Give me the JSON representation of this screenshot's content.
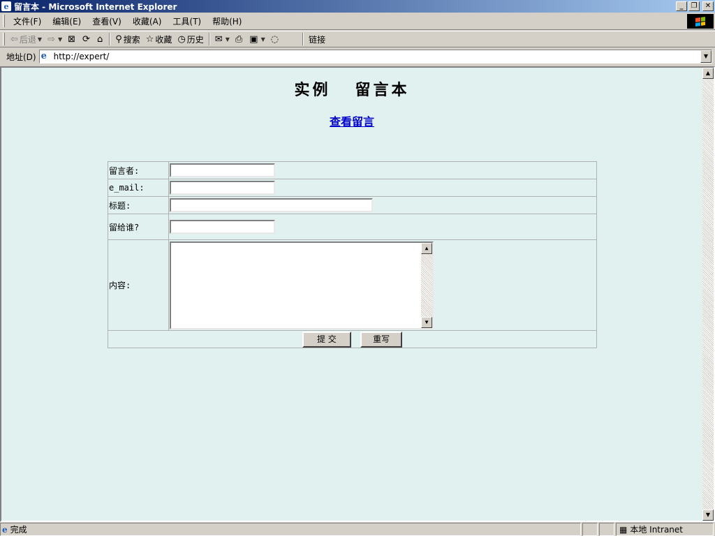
{
  "window": {
    "title": "留言本 - Microsoft Internet Explorer",
    "buttons": {
      "minimize": "_",
      "maximize": "❐",
      "close": "✕"
    }
  },
  "menu": {
    "items": [
      "文件(F)",
      "编辑(E)",
      "查看(V)",
      "收藏(A)",
      "工具(T)",
      "帮助(H)"
    ]
  },
  "toolbar": {
    "back": "后退",
    "search": "搜索",
    "favorites": "收藏",
    "history": "历史",
    "links": "链接",
    "icons": [
      "back-arrow-icon",
      "forward-arrow-icon",
      "stop-icon",
      "refresh-icon",
      "home-icon",
      "search-icon",
      "favorites-icon",
      "history-icon",
      "mail-icon",
      "print-icon",
      "edit-icon",
      "discuss-icon"
    ]
  },
  "address": {
    "label": "地址(D)",
    "url": "http://expert/"
  },
  "page": {
    "title": "实例   留言本",
    "link": "查看留言",
    "form": {
      "author_label": "留言者:",
      "email_label": "e_mail:",
      "subject_label": "标题:",
      "recipient_label": "留给谁?",
      "content_label": "内容:",
      "author_value": "",
      "email_value": "",
      "subject_value": "",
      "recipient_value": "",
      "content_value": "",
      "submit": "提 交",
      "reset": "重写"
    }
  },
  "status": {
    "text": "完成",
    "zone": "本地 Intranet"
  },
  "colors": {
    "page_background": "#e0f1ef",
    "titlebar_start": "#0a246a",
    "titlebar_end": "#a6caf0",
    "link": "#0000cc",
    "chrome": "#d4d0c8"
  }
}
